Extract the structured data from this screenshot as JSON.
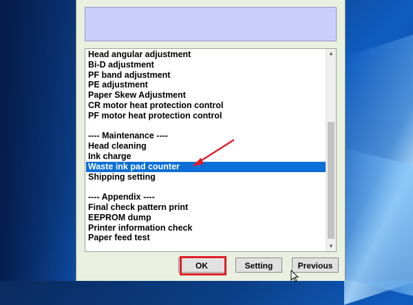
{
  "dialog": {
    "list_items": [
      {
        "label": "Head angular adjustment",
        "selected": false
      },
      {
        "label": "Bi-D adjustment",
        "selected": false
      },
      {
        "label": "PF band adjustment",
        "selected": false
      },
      {
        "label": "PE adjustment",
        "selected": false
      },
      {
        "label": "Paper Skew Adjustment",
        "selected": false
      },
      {
        "label": "CR motor heat protection control",
        "selected": false
      },
      {
        "label": "PF motor heat protection control",
        "selected": false
      },
      {
        "label": "",
        "selected": false
      },
      {
        "label": "---- Maintenance ----",
        "selected": false
      },
      {
        "label": "Head cleaning",
        "selected": false
      },
      {
        "label": "Ink charge",
        "selected": false
      },
      {
        "label": "Waste ink pad counter",
        "selected": true
      },
      {
        "label": "Shipping setting",
        "selected": false
      },
      {
        "label": "",
        "selected": false
      },
      {
        "label": "---- Appendix ----",
        "selected": false
      },
      {
        "label": "Final check pattern print",
        "selected": false
      },
      {
        "label": "EEPROM dump",
        "selected": false
      },
      {
        "label": "Printer information check",
        "selected": false
      },
      {
        "label": "Paper feed test",
        "selected": false
      }
    ],
    "buttons": {
      "ok": "OK",
      "setting": "Setting",
      "previous": "Previous"
    }
  },
  "colors": {
    "selection": "#0a6fd6",
    "annotation_red": "#e01b24",
    "info_box": "#c9cffa",
    "dialog_bg": "#e9f0e0"
  }
}
